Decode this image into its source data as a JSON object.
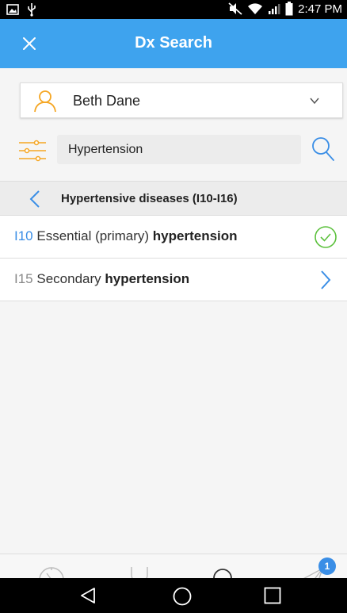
{
  "status_bar": {
    "time": "2:47 PM"
  },
  "app_bar": {
    "title": "Dx Search",
    "close_icon": "close-icon"
  },
  "patient": {
    "name": "Beth Dane",
    "icon": "user-icon"
  },
  "search": {
    "value": "Hypertension",
    "filter_icon": "filter-sliders-icon",
    "search_icon": "search-icon"
  },
  "category": {
    "label": "Hypertensive diseases (I10-I16)"
  },
  "results": [
    {
      "code": "I10",
      "text_pre": " Essential (primary) ",
      "text_bold": "hypertension",
      "state": "selected"
    },
    {
      "code": "I15",
      "text_pre": " Secondary ",
      "text_bold": "hypertension",
      "state": "expandable"
    }
  ],
  "tabs": [
    {
      "name": "history",
      "icon": "clock-icon"
    },
    {
      "name": "clinical",
      "icon": "stethoscope-icon"
    },
    {
      "name": "search",
      "icon": "search-icon"
    },
    {
      "name": "send",
      "icon": "send-icon",
      "badge": "1"
    }
  ],
  "colors": {
    "accent": "#3ea3ee",
    "link": "#3a8ee6",
    "check": "#5cc13d",
    "user_icon": "#f5a623"
  }
}
